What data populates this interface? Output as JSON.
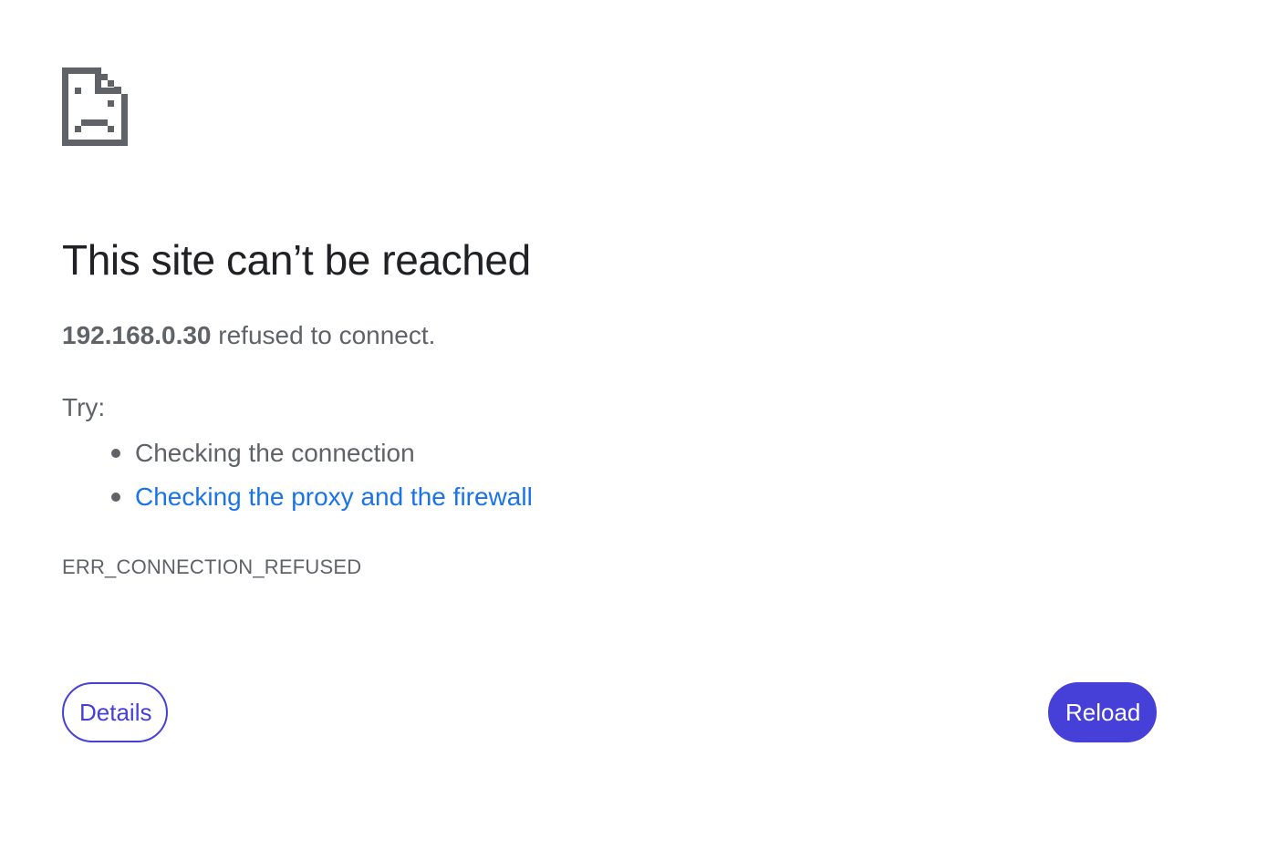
{
  "error_icon": "sad-page-icon",
  "title": "This site can’t be reached",
  "summary": {
    "host": "192.168.0.30",
    "message": " refused to connect."
  },
  "try_label": "Try:",
  "suggestions": [
    {
      "text": "Checking the connection",
      "is_link": false
    },
    {
      "text": "Checking the proxy and the firewall",
      "is_link": true
    }
  ],
  "error_code": "ERR_CONNECTION_REFUSED",
  "buttons": {
    "details_label": "Details",
    "reload_label": "Reload"
  },
  "colors": {
    "accent": "#4640d8",
    "link": "#1a73e8",
    "heading": "#202124",
    "body_text": "#5f6368",
    "icon": "#5f6368"
  }
}
